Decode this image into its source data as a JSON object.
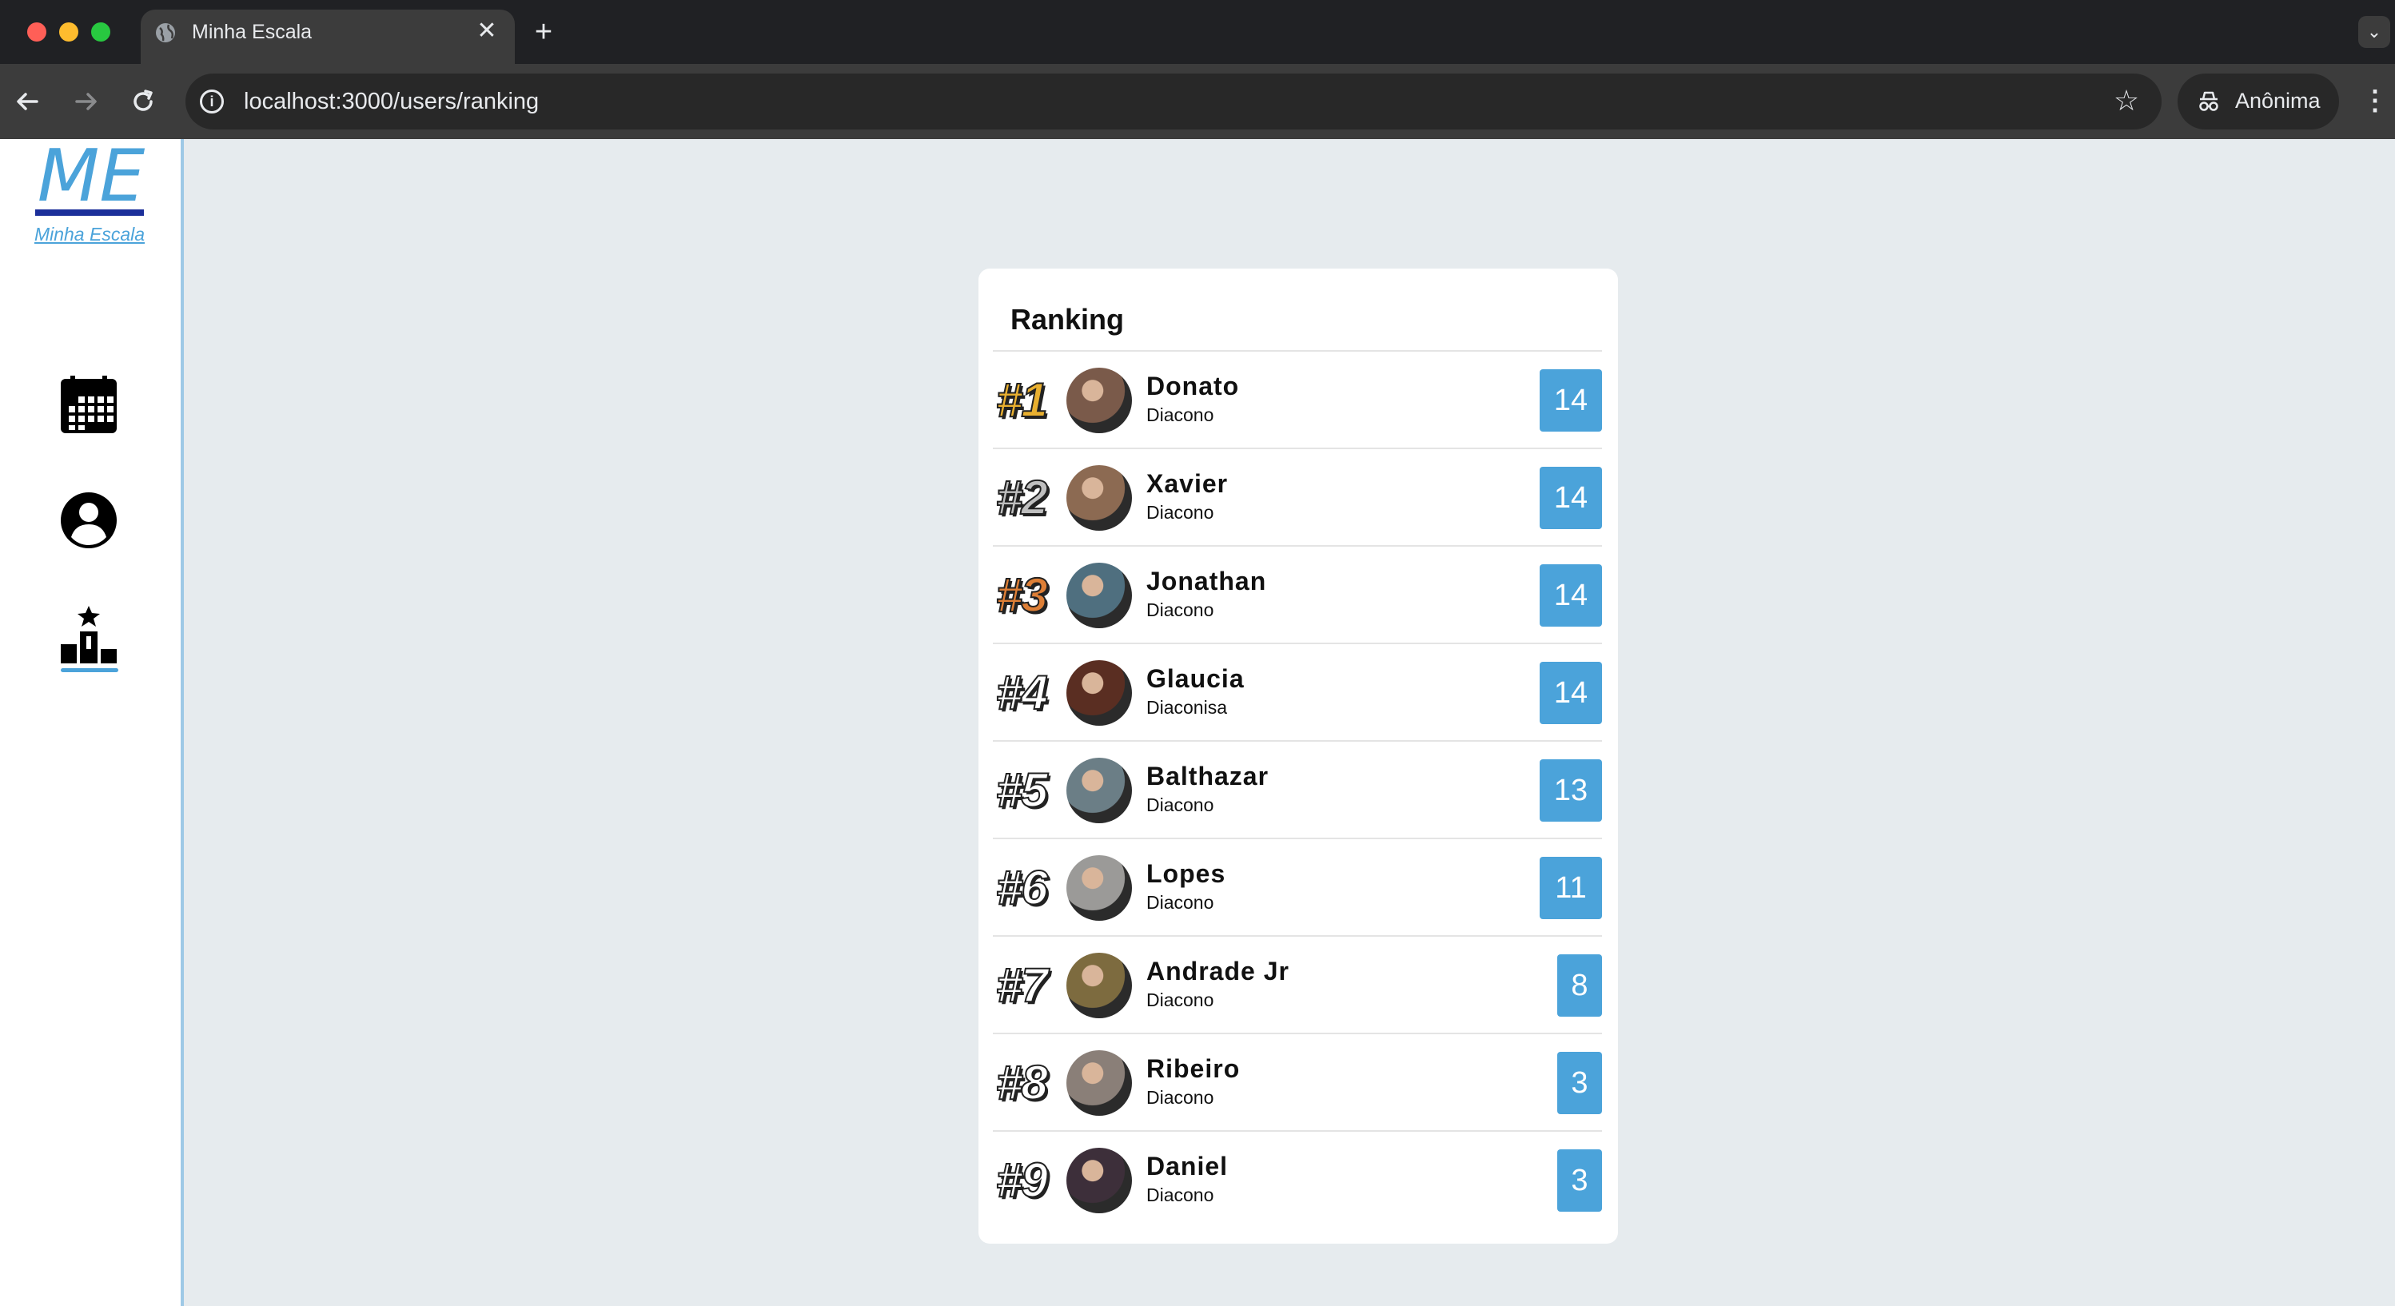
{
  "browser": {
    "tab_title": "Minha Escala",
    "url": "localhost:3000/users/ranking",
    "profile_label": "Anônima",
    "new_tab_symbol": "+",
    "tab_close_symbol": "✕"
  },
  "sidebar": {
    "logo": "ME",
    "logo_subtitle": "Minha Escala",
    "items": [
      {
        "icon": "calendar-icon"
      },
      {
        "icon": "user-icon"
      },
      {
        "icon": "podium-icon",
        "active": true
      }
    ]
  },
  "ranking": {
    "title": "Ranking",
    "rows": [
      {
        "rank": "#1",
        "name": "Donato",
        "role": "Diacono",
        "score": "14",
        "avatar_color": "#7a5a4a"
      },
      {
        "rank": "#2",
        "name": "Xavier",
        "role": "Diacono",
        "score": "14",
        "avatar_color": "#8c6a52"
      },
      {
        "rank": "#3",
        "name": "Jonathan",
        "role": "Diacono",
        "score": "14",
        "avatar_color": "#4f6f7f"
      },
      {
        "rank": "#4",
        "name": "Glaucia",
        "role": "Diaconisa",
        "score": "14",
        "avatar_color": "#5a2e22"
      },
      {
        "rank": "#5",
        "name": "Balthazar",
        "role": "Diacono",
        "score": "13",
        "avatar_color": "#6b7e86"
      },
      {
        "rank": "#6",
        "name": "Lopes",
        "role": "Diacono",
        "score": "11",
        "avatar_color": "#9b9a98"
      },
      {
        "rank": "#7",
        "name": "Andrade Jr",
        "role": "Diacono",
        "score": "8",
        "avatar_color": "#7d6b3f"
      },
      {
        "rank": "#8",
        "name": "Ribeiro",
        "role": "Diacono",
        "score": "3",
        "avatar_color": "#8a7f78"
      },
      {
        "rank": "#9",
        "name": "Daniel",
        "role": "Diacono",
        "score": "3",
        "avatar_color": "#3d2f3a"
      }
    ]
  },
  "colors": {
    "accent": "#4ba3da",
    "gold": "#e9b030",
    "silver": "#bfbfbf",
    "bronze": "#de7f36"
  }
}
